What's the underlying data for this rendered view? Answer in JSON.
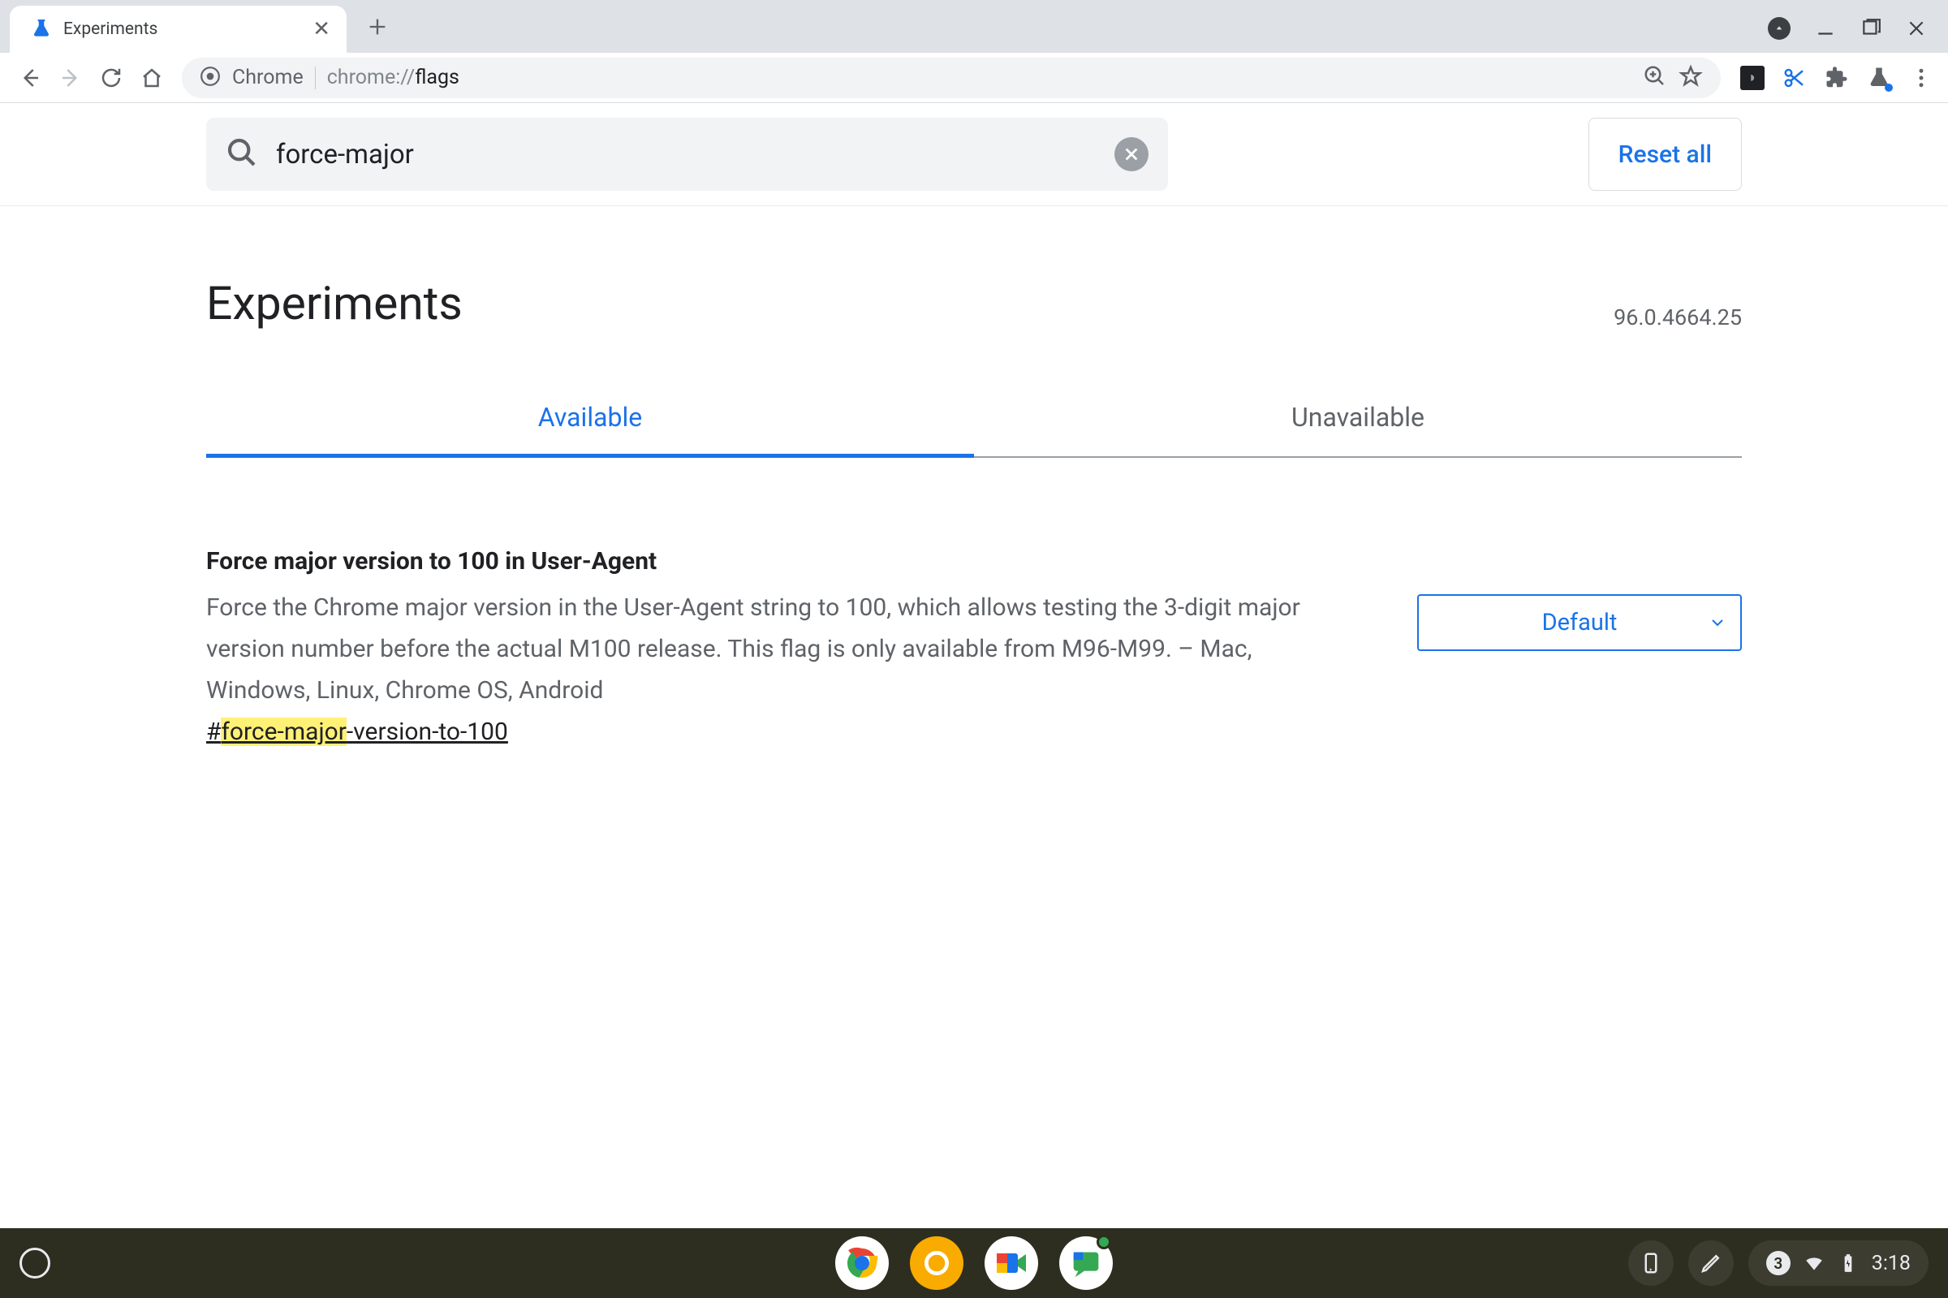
{
  "browser": {
    "tab_title": "Experiments",
    "omnibox_origin": "Chrome",
    "omnibox_path_pre": "chrome://",
    "omnibox_path_bold": "flags"
  },
  "search": {
    "value": "force-major",
    "reset_label": "Reset all"
  },
  "page": {
    "heading": "Experiments",
    "version": "96.0.4664.25",
    "tab_available": "Available",
    "tab_unavailable": "Unavailable"
  },
  "flag": {
    "title": "Force major version to 100 in User-Agent",
    "description": "Force the Chrome major version in the User-Agent string to 100, which allows testing the 3-digit major version number before the actual M100 release. This flag is only available from M96-M99. – Mac, Windows, Linux, Chrome OS, Android",
    "anchor_hash": "#",
    "anchor_highlight": "force-major",
    "anchor_rest": "-version-to-100",
    "select_value": "Default"
  },
  "shelf": {
    "notification_count": "3",
    "clock": "3:18"
  }
}
